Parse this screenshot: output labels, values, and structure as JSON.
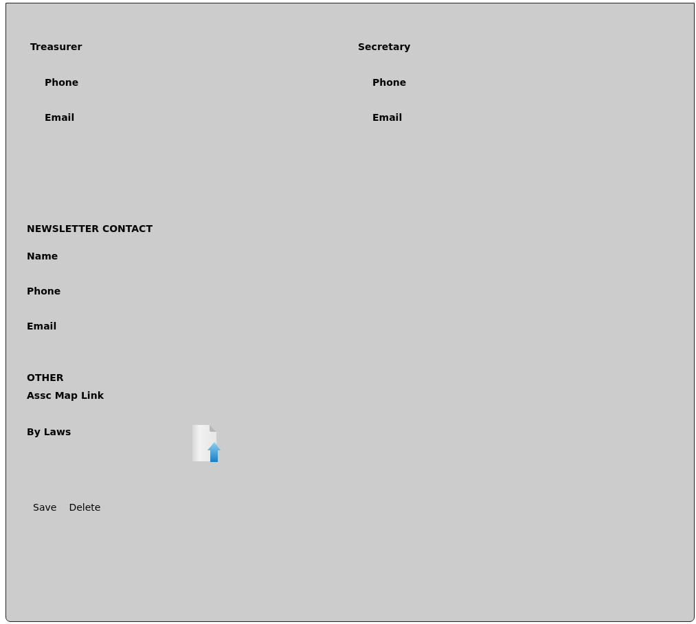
{
  "officers": [
    {
      "title": "Treasurer",
      "fields": [
        "Phone",
        "Email"
      ]
    },
    {
      "title": "Secretary",
      "fields": [
        "Phone",
        "Email"
      ]
    }
  ],
  "newsletter": {
    "heading": "NEWSLETTER CONTACT",
    "fields": [
      "Name",
      "Phone",
      "Email"
    ]
  },
  "other": {
    "heading": "OTHER",
    "fields": [
      {
        "label": "Assc Map Link",
        "kind": "text"
      },
      {
        "label": "By Laws",
        "kind": "upload"
      }
    ]
  },
  "buttons": [
    "Save",
    "Delete"
  ]
}
